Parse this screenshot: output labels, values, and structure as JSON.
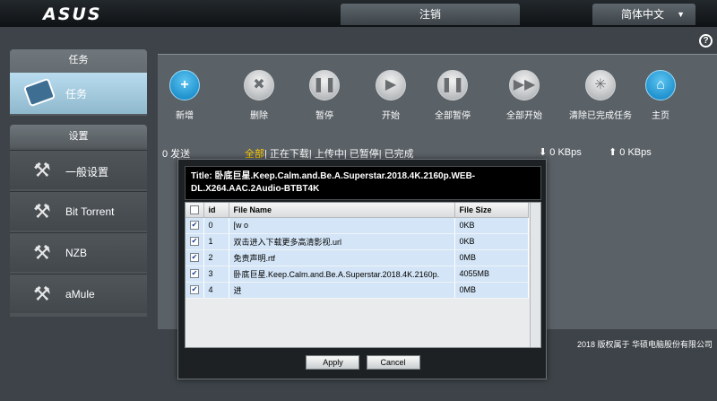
{
  "header": {
    "logo": "ASUS",
    "logout_label": "注销",
    "language": "简体中文"
  },
  "sidebar": {
    "task_group_title": "任务",
    "task_item_label": "任务",
    "settings_group_title": "设置",
    "settings_items": [
      {
        "label": "一般设置"
      },
      {
        "label": "Bit Torrent"
      },
      {
        "label": "NZB"
      },
      {
        "label": "aMule"
      }
    ]
  },
  "toolbar": [
    {
      "label": "新增",
      "icon": "plus-icon"
    },
    {
      "label": "删除",
      "icon": "x-icon"
    },
    {
      "label": "暂停",
      "icon": "pause-icon"
    },
    {
      "label": "开始",
      "icon": "play-icon"
    },
    {
      "label": "全部暂停",
      "icon": "pause-all-icon"
    },
    {
      "label": "全部开始",
      "icon": "start-all-icon"
    },
    {
      "label": "清除已完成任务",
      "icon": "clear-icon"
    },
    {
      "label": "主页",
      "icon": "home-icon"
    }
  ],
  "status_bar": {
    "sent": "0 发送",
    "filter_all": "全部",
    "filter_rest": "| 正在下载| 上传中| 已暂停| 已完成",
    "download_rate": "0 KBps",
    "upload_rate": "0 KBps"
  },
  "dialog": {
    "title": "Title: 卧底巨星.Keep.Calm.and.Be.A.Superstar.2018.4K.2160p.WEB-DL.X264.AAC.2Audio-BTBT4K",
    "columns": [
      "id",
      "File Name",
      "File Size"
    ],
    "files": [
      {
        "id": "0",
        "name": "[w                                    o",
        "size": "0KB",
        "checked": true
      },
      {
        "id": "1",
        "name": "双击进入下载更多高清影视.url",
        "size": "0KB",
        "checked": true
      },
      {
        "id": "2",
        "name": "免责声明.rtf",
        "size": "0MB",
        "checked": true
      },
      {
        "id": "3",
        "name": "卧底巨星.Keep.Calm.and.Be.A.Superstar.2018.4K.2160p.",
        "size": "4055MB",
        "checked": true
      },
      {
        "id": "4",
        "name": "进",
        "size": "0MB",
        "checked": true
      }
    ],
    "apply_label": "Apply",
    "cancel_label": "Cancel"
  },
  "footer": {
    "copyright": "2018 版权属于 华硕电脑股份有限公司"
  }
}
